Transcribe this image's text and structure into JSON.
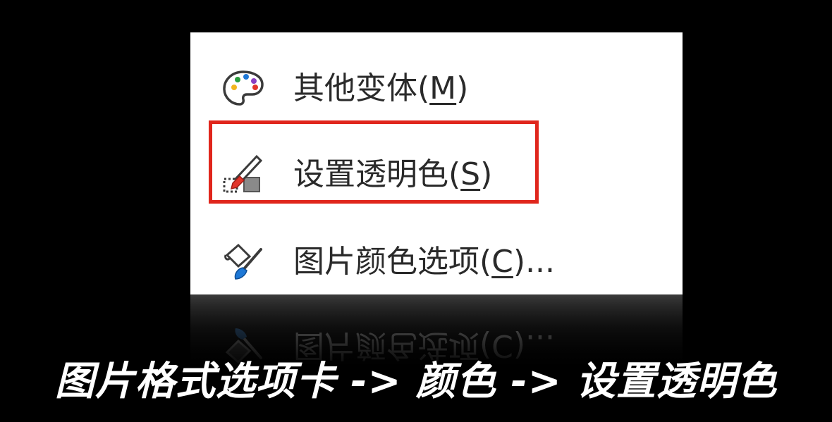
{
  "menu": {
    "items": [
      {
        "label": "其他变体(",
        "key": "M",
        "suffix": ")",
        "icon": "palette-icon"
      },
      {
        "label": "设置透明色(",
        "key": "S",
        "suffix": ")",
        "icon": "set-transparent-color-icon"
      },
      {
        "label": "图片颜色选项(",
        "key": "C",
        "suffix": ")...",
        "icon": "picture-color-options-icon"
      }
    ],
    "highlighted_index": 1
  },
  "caption": {
    "text": "图片格式选项卡 -> 颜色 -> 设置透明色"
  },
  "colors": {
    "background": "#000000",
    "menu_background": "#ffffff",
    "highlight_border": "#e0261c",
    "caption_text": "#ffffff"
  }
}
